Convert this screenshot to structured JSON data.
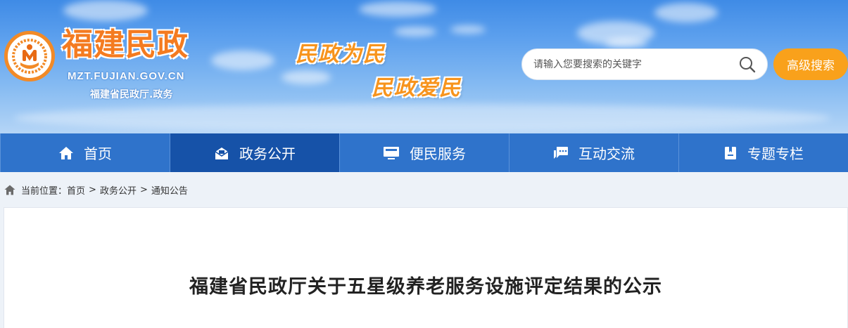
{
  "site": {
    "name": "福建民政",
    "domain": "MZT.FUJIAN.GOV.CN",
    "subtitle": "福建省民政厅.政务",
    "slogan_1": "民政为民",
    "slogan_2": "民政爱民"
  },
  "search": {
    "placeholder": "请输入您要搜索的关键字",
    "advanced_label": "高级搜索"
  },
  "nav": {
    "items": [
      {
        "label": "首页",
        "icon": "home-icon",
        "active": false
      },
      {
        "label": "政务公开",
        "icon": "envelope-icon",
        "active": true
      },
      {
        "label": "便民服务",
        "icon": "monitor-icon",
        "active": false
      },
      {
        "label": "互动交流",
        "icon": "chat-icon",
        "active": false
      },
      {
        "label": "专题专栏",
        "icon": "bookmark-icon",
        "active": false
      }
    ]
  },
  "breadcrumb": {
    "prefix": "当前位置：",
    "items": [
      "首页",
      "政务公开",
      "通知公告"
    ],
    "separator": ">"
  },
  "article": {
    "title": "福建省民政厅关于五星级养老服务设施评定结果的公示"
  },
  "colors": {
    "accent_orange": "#f9a11b",
    "nav_blue": "#2f73cb",
    "nav_active": "#1652a8"
  }
}
